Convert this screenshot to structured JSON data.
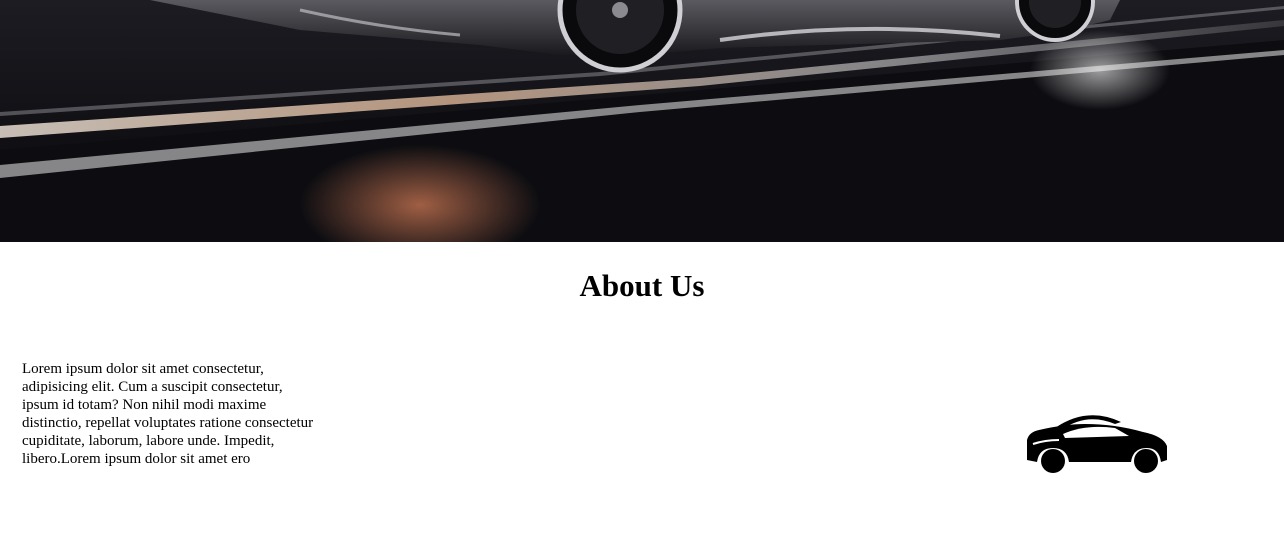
{
  "hero": {
    "image": "sports-car-on-night-road-photo"
  },
  "about": {
    "title": "About Us",
    "body": "Lorem ipsum dolor sit amet consectetur, adipisicing elit. Cum a suscipit consectetur, ipsum id totam? Non nihil modi maxime distinctio, repellat voluptates ratione consectetur cupiditate, laborum, labore unde. Impedit, libero.Lorem ipsum dolor sit amet ero",
    "icon": "car-icon"
  }
}
